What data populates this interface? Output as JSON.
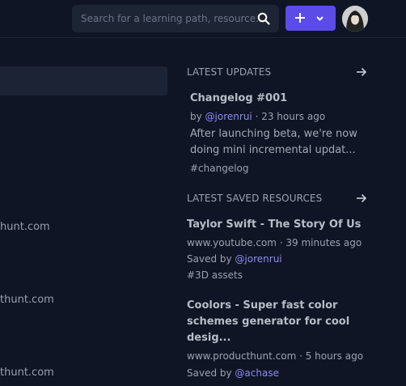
{
  "header": {
    "search_placeholder": "Search for a learning path, resource...",
    "search_icon": "search-icon",
    "add_icon": "plus-icon",
    "dropdown_icon": "chevron-down-icon",
    "accent": "#5b4ce8"
  },
  "left": {
    "urls": [
      "hunt.com",
      "thunt.com",
      "thunt.com"
    ]
  },
  "updates": {
    "title": "LATEST UPDATES",
    "items": [
      {
        "title": "Changelog #001",
        "by": "by ",
        "user": "@jorenrui",
        "time": " · 23 hours ago",
        "text": "After launching beta, we're now doing mini incremental updat...",
        "tag": "#changelog"
      }
    ]
  },
  "saved": {
    "title": "LATEST SAVED RESOURCES",
    "items": [
      {
        "title": "Taylor Swift - The Story Of Us",
        "meta": "www.youtube.com · 39 minutes ago",
        "saved_by": "Saved by ",
        "user": "@jorenrui",
        "tag": "#3D assets"
      },
      {
        "title_l1": "Coolors - Super fast color",
        "title_l2": "schemes generator for cool",
        "title_l3": "desig...",
        "meta": "www.producthunt.com · 5 hours ago",
        "saved_by": "Saved by ",
        "user": "@achase"
      }
    ]
  }
}
